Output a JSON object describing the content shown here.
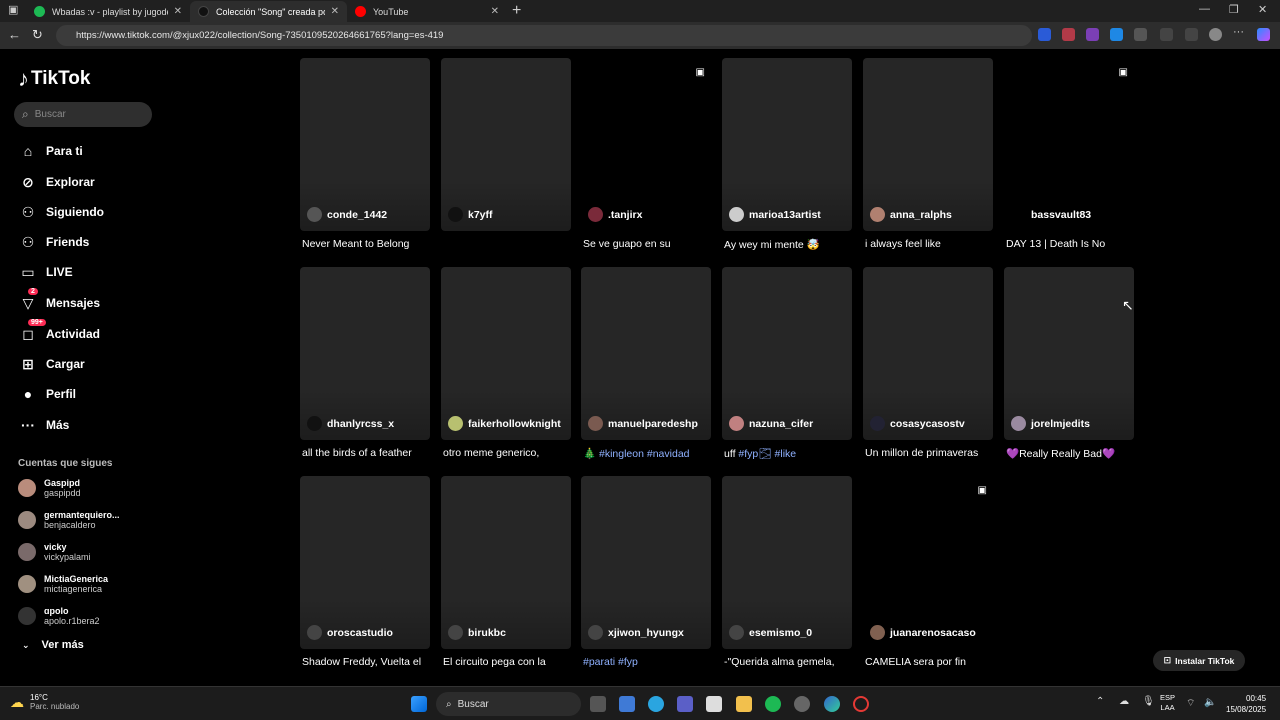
{
  "browser": {
    "tabs": [
      {
        "title": "Wbadas :v - playlist by jugodeuva",
        "favicon_color": "#1db954"
      },
      {
        "title": "Colección \"Song\" creada por xjux",
        "favicon_color": "#000000"
      },
      {
        "title": "YouTube",
        "favicon_color": "#ff0000"
      }
    ],
    "url": "https://www.tiktok.com/@xjux022/collection/Song-7350109520264661765?lang=es-419"
  },
  "sidebar": {
    "logo": "TikTok",
    "search_placeholder": "Buscar",
    "nav": [
      {
        "label": "Para ti",
        "icon": "home-icon",
        "glyph": "⌂"
      },
      {
        "label": "Explorar",
        "icon": "compass-icon",
        "glyph": "⊘"
      },
      {
        "label": "Siguiendo",
        "icon": "following-icon",
        "glyph": "⚇"
      },
      {
        "label": "Friends",
        "icon": "friends-icon",
        "glyph": "⚇"
      },
      {
        "label": "LIVE",
        "icon": "live-icon",
        "glyph": "▭"
      },
      {
        "label": "Mensajes",
        "icon": "messages-icon",
        "glyph": "▽",
        "badge": "2"
      },
      {
        "label": "Actividad",
        "icon": "activity-icon",
        "glyph": "◻",
        "badge": "99+"
      },
      {
        "label": "Cargar",
        "icon": "upload-icon",
        "glyph": "⊞"
      },
      {
        "label": "Perfil",
        "icon": "profile-icon",
        "glyph": "●"
      },
      {
        "label": "Más",
        "icon": "more-icon",
        "glyph": "···"
      }
    ],
    "following_header": "Cuentas que sigues",
    "following": [
      {
        "name": "Gaspipd",
        "handle": "gaspipdd"
      },
      {
        "name": "germantequiero...",
        "handle": "benjacaldero"
      },
      {
        "name": "vicky",
        "handle": "vickypalami"
      },
      {
        "name": "MictiaGenerica",
        "handle": "mictiagenerica"
      },
      {
        "name": "ɑpolo",
        "handle": "apolo.r1bera2"
      }
    ],
    "see_more": "Ver más"
  },
  "videos": [
    {
      "user": "conde_1442",
      "caption": "Never Meant to Belong",
      "dark": false,
      "photo": false,
      "avatar": "#555555"
    },
    {
      "user": "k7yff",
      "caption": "",
      "dark": false,
      "photo": false,
      "avatar": "#111111"
    },
    {
      "user": ".tanjirx",
      "caption": "Se ve guapo en su",
      "dark": true,
      "photo": true,
      "avatar": "#7a2a3a"
    },
    {
      "user": "marioa13artist",
      "caption": "Ay wey mi mente 🤯",
      "dark": false,
      "photo": false,
      "avatar": "#cccccc"
    },
    {
      "user": "anna_ralphs",
      "caption": "i always feel like",
      "dark": false,
      "photo": false,
      "avatar": "#b08070"
    },
    {
      "user": "bassvault83",
      "caption": "DAY 13 | Death Is No",
      "dark": true,
      "photo": true,
      "avatar": "#000000"
    },
    {
      "user": "dhanlyrcss_x",
      "caption": "all the birds of a feather",
      "dark": false,
      "photo": false,
      "avatar": "#111111"
    },
    {
      "user": "faikerhollowknight",
      "caption": "otro meme generico,",
      "dark": false,
      "photo": false,
      "avatar": "#b8c070"
    },
    {
      "user": "manuelparedeshp",
      "caption": "🎄 #kingleon #navidad",
      "dark": false,
      "photo": false,
      "avatar": "#7a5a50"
    },
    {
      "user": "nazuna_cifer",
      "caption": "uff #fyp🌫 #like",
      "dark": false,
      "photo": false,
      "avatar": "#c08080"
    },
    {
      "user": "cosasycasostv",
      "caption": "Un millon de primaveras",
      "dark": false,
      "photo": false,
      "avatar": "#222233"
    },
    {
      "user": "jorelmjedits",
      "caption": "💜Really Really Bad💜",
      "dark": false,
      "photo": false,
      "avatar": "#9a8aa0"
    },
    {
      "user": "oroscastudio",
      "caption": "Shadow Freddy, Vuelta el",
      "dark": false,
      "photo": false,
      "avatar": "#444444"
    },
    {
      "user": "birukbc",
      "caption": "El circuito pega con la",
      "dark": false,
      "photo": false,
      "avatar": "#444444"
    },
    {
      "user": "xjiwon_hyungx",
      "caption": "#parati #fyp",
      "dark": false,
      "photo": false,
      "avatar": "#444444"
    },
    {
      "user": "esemismo_0",
      "caption": "-\"Querida alma gemela,",
      "dark": false,
      "photo": false,
      "avatar": "#444444"
    },
    {
      "user": "juanarenosacaso",
      "caption": "CAMELIA sera por fin",
      "dark": true,
      "photo": true,
      "avatar": "#806050"
    }
  ],
  "install_button": "Instalar TikTok",
  "taskbar": {
    "weather_temp": "16°C",
    "weather_desc": "Parc. nublado",
    "search_label": "Buscar",
    "lang_line1": "ESP",
    "lang_line2": "LAA",
    "time": "00:45",
    "date": "15/08/2025"
  },
  "colors": {
    "accent": "#fe2c55",
    "hashtag": "#8fb1ff",
    "card_bg": "#262626"
  }
}
